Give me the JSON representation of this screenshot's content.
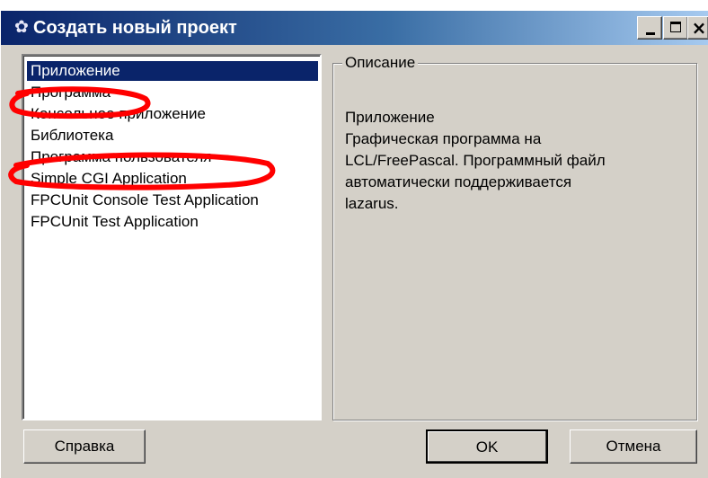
{
  "window": {
    "title": "Создать новый проект",
    "icon": "lazarus-app-icon"
  },
  "titlebar_buttons": {
    "minimize": "minimize",
    "maximize": "maximize",
    "close": "×"
  },
  "project_types": {
    "items": [
      "Приложение",
      "Программа",
      "Консольное приложение",
      "Библиотека",
      "Программа пользователя",
      "Simple CGI Application",
      "FPCUnit Console Test Application",
      "FPCUnit Test Application"
    ],
    "selected": "Приложение"
  },
  "description": {
    "legend": "Описание",
    "lines": [
      "Приложение",
      "Графическая программа на",
      "LCL/FreePascal. Программный файл",
      "автоматически поддерживается",
      "lazarus."
    ]
  },
  "buttons": {
    "help": "Справка",
    "ok": "OK",
    "cancel": "Отмена"
  },
  "annotations": {
    "color": "#ff0000",
    "marked_items": [
      "Программа",
      "Программа пользователя"
    ]
  }
}
